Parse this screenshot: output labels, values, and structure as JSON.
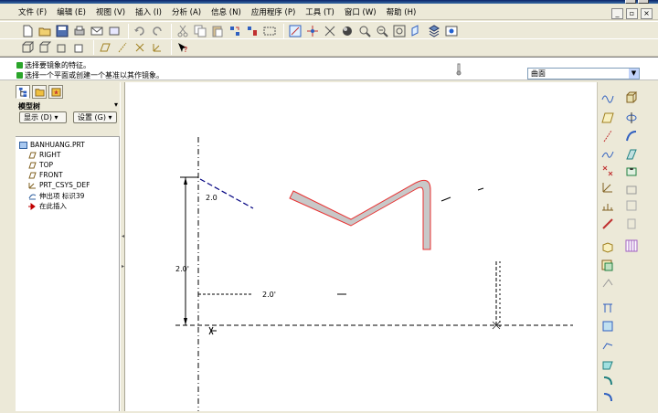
{
  "menu": {
    "items": [
      "文件 (F)",
      "编辑 (E)",
      "视图 (V)",
      "插入 (I)",
      "分析 (A)",
      "信息 (N)",
      "应用程序 (P)",
      "工具 (T)",
      "窗口 (W)",
      "帮助 (H)"
    ]
  },
  "messages": {
    "line1": "选择要镜象的特征。",
    "line2": "选择一个平面或创建一个基准以其作镜象。"
  },
  "filter": {
    "value": "曲面"
  },
  "nav": {
    "tree_title": "模型树",
    "show_label": "显示 (D) ▾",
    "settings_label": "设置 (G) ▾"
  },
  "tree": {
    "items": [
      {
        "label": "BANHUANG.PRT",
        "icon": "part-icon"
      },
      {
        "label": "RIGHT",
        "icon": "datum-plane-icon"
      },
      {
        "label": "TOP",
        "icon": "datum-plane-icon"
      },
      {
        "label": "FRONT",
        "icon": "datum-plane-icon"
      },
      {
        "label": "PRT_CSYS_DEF",
        "icon": "csys-icon"
      },
      {
        "label": "伸出项 标识39",
        "icon": "extrude-icon"
      },
      {
        "label": "在此插入",
        "icon": "insert-here-icon"
      }
    ]
  },
  "sketch": {
    "dim_top": "2.0",
    "dim_left": "2.0'",
    "dim_bottom": "2.0'"
  },
  "colors": {
    "profile_fill": "#c8c8c8",
    "profile_edge": "#e83030",
    "dim_line": "#000080",
    "accent": "#0a246a"
  }
}
